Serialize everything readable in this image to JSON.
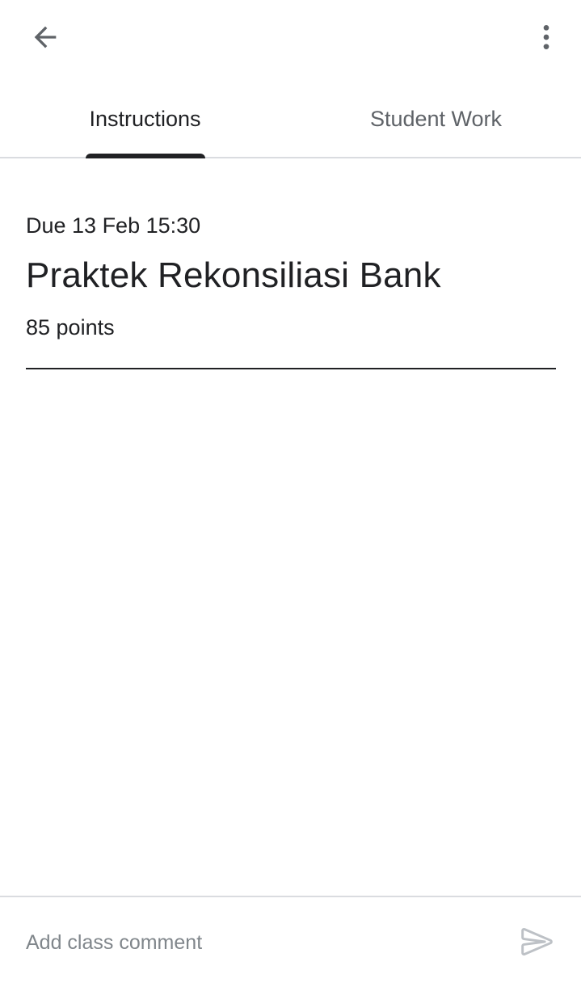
{
  "header": {
    "back_icon": "arrow-back-icon",
    "more_icon": "more-vert-icon"
  },
  "tabs": [
    {
      "label": "Instructions",
      "selected": true
    },
    {
      "label": "Student Work",
      "selected": false
    }
  ],
  "assignment": {
    "due": "Due 13 Feb 15:30",
    "title": "Praktek Rekonsiliasi Bank",
    "points": "85 points"
  },
  "comment": {
    "placeholder": "Add class comment",
    "value": "",
    "send_icon": "send-icon"
  },
  "colors": {
    "primary_text": "#202124",
    "secondary_text": "#5f6368",
    "divider": "#dadce0",
    "disabled_icon": "#bdc1c6"
  }
}
